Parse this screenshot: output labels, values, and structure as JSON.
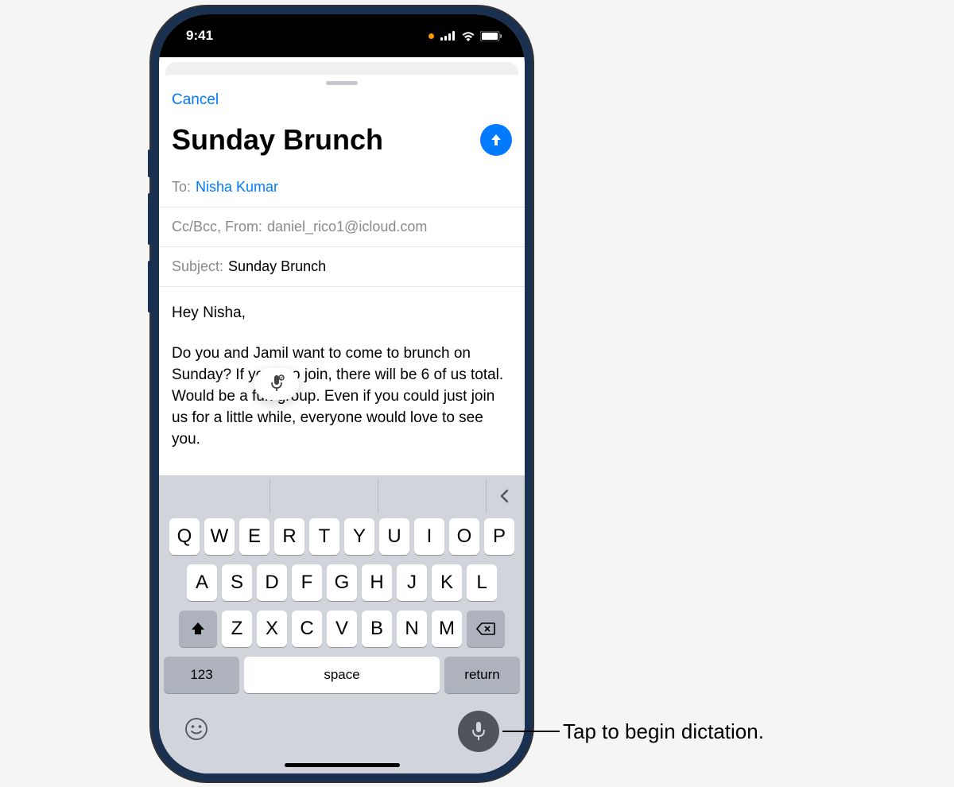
{
  "statusBar": {
    "time": "9:41"
  },
  "compose": {
    "cancel": "Cancel",
    "title": "Sunday Brunch",
    "toLabel": "To:",
    "toRecipient": "Nisha Kumar",
    "ccLabel": "Cc/Bcc, From:",
    "fromAddress": "daniel_rico1@icloud.com",
    "subjectLabel": "Subject:",
    "subjectValue": "Sunday Brunch",
    "bodyGreeting": "Hey Nisha,",
    "bodyText": "Do you and Jamil want to come to brunch on Sunday? If you two join, there will be 6 of us total. Would be a fun group. Even if you could just join us for a little while, everyone would love to see you."
  },
  "keyboard": {
    "row1": [
      "Q",
      "W",
      "E",
      "R",
      "T",
      "Y",
      "U",
      "I",
      "O",
      "P"
    ],
    "row2": [
      "A",
      "S",
      "D",
      "F",
      "G",
      "H",
      "J",
      "K",
      "L"
    ],
    "row3": [
      "Z",
      "X",
      "C",
      "V",
      "B",
      "N",
      "M"
    ],
    "numKey": "123",
    "spaceKey": "space",
    "returnKey": "return"
  },
  "callout": {
    "text": "Tap to begin dictation."
  }
}
